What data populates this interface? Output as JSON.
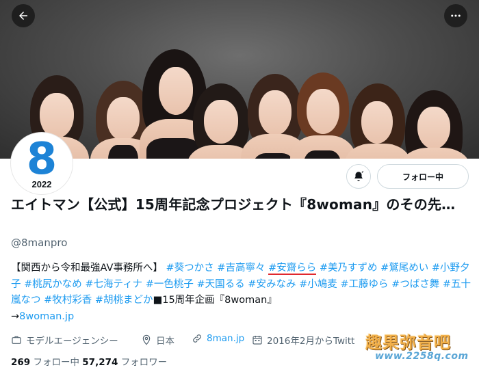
{
  "header": {
    "back_icon": "arrow-left-icon",
    "more_icon": "more-horizontal-icon"
  },
  "avatar": {
    "numeral": "8",
    "year": "2022",
    "brand_color": "#1d83d6"
  },
  "actions": {
    "notify_icon": "bell-icon",
    "follow_label": "フォロー中"
  },
  "profile": {
    "name": "エイトマン【公式】15周年記念プロジェクト『8woman』のその先…",
    "handle": "@8manpro"
  },
  "bio": {
    "intro": "【関西から令和最強AV事務所へ】",
    "tags": [
      "#葵つかさ",
      "#吉高寧々",
      "#安齋らら",
      "#美乃すずめ",
      "#鷲尾めい",
      "#小野夕子",
      "#桃尻かなめ",
      "#七海ティナ",
      "#一色桃子",
      "#天国るる",
      "#安みなみ",
      "#小鳩麦",
      "#工藤ゆら",
      "#つばさ舞",
      "#五十嵐なつ",
      "#牧村彩香",
      "#胡桃まどか"
    ],
    "project": "■15周年企画『8woman』",
    "arrow": "→",
    "link": "8woman.jp",
    "tag_color": "#1d9bf0",
    "highlight_color": "#e0282e"
  },
  "meta": {
    "category": "モデルエージェンシー",
    "location": "日本",
    "website": "8man.jp",
    "joined": "2016年2月からTwitt"
  },
  "counts": {
    "following_num": "269",
    "following_label": "フォロー中",
    "followers_num": "57,274",
    "followers_label": "フォロワー"
  },
  "watermark": {
    "title": "趣果弥音吧",
    "url": "www.2258q.com"
  }
}
